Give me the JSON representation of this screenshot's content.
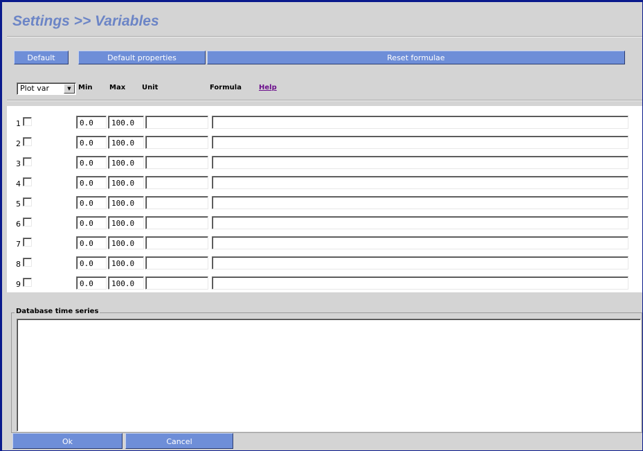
{
  "title": "Settings >> Variables",
  "toolbar": {
    "default_label": "Default",
    "default_properties_label": "Default properties",
    "reset_formulae_label": "Reset formulae"
  },
  "header": {
    "plot_select_value": "Plot var",
    "col_min": "Min",
    "col_max": "Max",
    "col_unit": "Unit",
    "col_formula": "Formula",
    "help_link": "Help"
  },
  "rows": [
    {
      "num": "1",
      "checked": false,
      "min": "0.0",
      "max": "100.0",
      "unit": "",
      "formula": ""
    },
    {
      "num": "2",
      "checked": false,
      "min": "0.0",
      "max": "100.0",
      "unit": "",
      "formula": ""
    },
    {
      "num": "3",
      "checked": false,
      "min": "0.0",
      "max": "100.0",
      "unit": "",
      "formula": ""
    },
    {
      "num": "4",
      "checked": false,
      "min": "0.0",
      "max": "100.0",
      "unit": "",
      "formula": ""
    },
    {
      "num": "5",
      "checked": false,
      "min": "0.0",
      "max": "100.0",
      "unit": "",
      "formula": ""
    },
    {
      "num": "6",
      "checked": false,
      "min": "0.0",
      "max": "100.0",
      "unit": "",
      "formula": ""
    },
    {
      "num": "7",
      "checked": false,
      "min": "0.0",
      "max": "100.0",
      "unit": "",
      "formula": ""
    },
    {
      "num": "8",
      "checked": false,
      "min": "0.0",
      "max": "100.0",
      "unit": "",
      "formula": ""
    },
    {
      "num": "9",
      "checked": false,
      "min": "0.0",
      "max": "100.0",
      "unit": "",
      "formula": ""
    }
  ],
  "database": {
    "legend": "Database time series",
    "content": ""
  },
  "footer": {
    "ok_label": "Ok",
    "cancel_label": "Cancel"
  },
  "colors": {
    "title": "#6c85c6",
    "button": "#6e8ed8",
    "frame": "#0a1a8c",
    "panel": "#d4d4d4",
    "help_link": "#6b0e8c"
  },
  "icons": {
    "select_arrow": "chevron-down-icon",
    "checkbox": "checkbox-icon"
  }
}
